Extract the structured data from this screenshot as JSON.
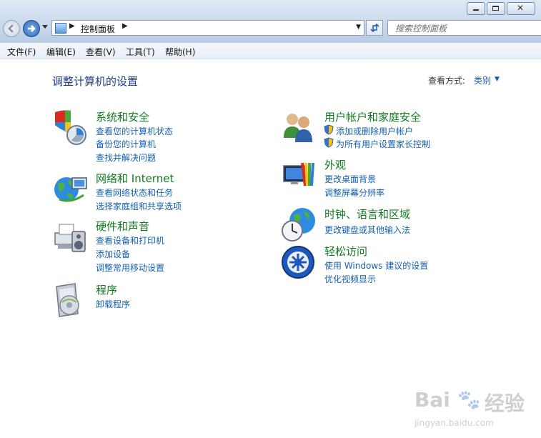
{
  "address": {
    "path_root": "控制面板"
  },
  "search": {
    "placeholder": "搜索控制面板"
  },
  "menu": [
    "文件(F)",
    "编辑(E)",
    "查看(V)",
    "工具(T)",
    "帮助(H)"
  ],
  "page": {
    "title": "调整计算机的设置",
    "view_by_label": "查看方式:",
    "view_by_value": "类别"
  },
  "categories": {
    "system_security": {
      "title": "系统和安全",
      "links": [
        "查看您的计算机状态",
        "备份您的计算机",
        "查找并解决问题"
      ]
    },
    "network": {
      "title": "网络和 Internet",
      "links": [
        "查看网络状态和任务",
        "选择家庭组和共享选项"
      ]
    },
    "hardware": {
      "title": "硬件和声音",
      "links": [
        "查看设备和打印机",
        "添加设备",
        "调整常用移动设置"
      ]
    },
    "programs": {
      "title": "程序",
      "links": [
        "卸载程序"
      ]
    },
    "user_accounts": {
      "title": "用户帐户和家庭安全",
      "links": [
        "添加或删除用户帐户",
        "为所有用户设置家长控制"
      ]
    },
    "appearance": {
      "title": "外观",
      "links": [
        "更改桌面背景",
        "调整屏幕分辨率"
      ]
    },
    "clock_region": {
      "title": "时钟、语言和区域",
      "links": [
        "更改键盘或其他输入法"
      ]
    },
    "ease_access": {
      "title": "轻松访问",
      "links": [
        "使用 Windows 建议的设置",
        "优化视频显示"
      ]
    }
  },
  "watermark": {
    "logo": "Bai",
    "logo2": "经验",
    "url": "jingyan.baidu.com"
  },
  "colors": {
    "title_green": "#0f7a1e",
    "link_blue": "#1560b0",
    "heading_blue": "#1e3a8a"
  }
}
